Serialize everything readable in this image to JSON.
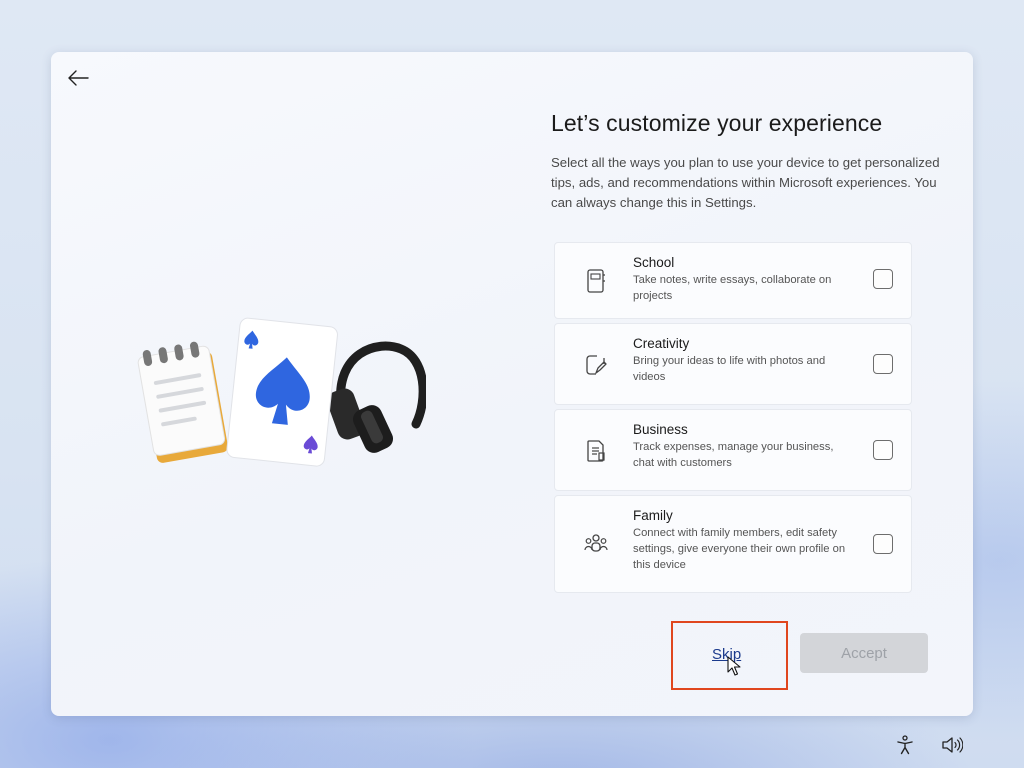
{
  "header": {
    "title": "Let’s customize your experience",
    "description": "Select all the ways you plan to use your device to get personalized tips, ads, and recommendations within Microsoft experiences. You can always change this in Settings."
  },
  "navigation": {
    "back_icon": "arrow-left-icon"
  },
  "illustration": {
    "icons": [
      "notepad-icon",
      "playing-card-spade-icon",
      "headphones-icon"
    ],
    "accent": "#3a5bd9"
  },
  "options": [
    {
      "label": "School",
      "description": "Take notes, write essays, collaborate on projects",
      "icon": "notebook-icon",
      "checked": false
    },
    {
      "label": "Creativity",
      "description": "Bring your ideas to life with photos and videos",
      "icon": "draw-image-icon",
      "checked": false
    },
    {
      "label": "Business",
      "description": "Track expenses, manage your business, chat with customers",
      "icon": "receipt-icon",
      "checked": false
    },
    {
      "label": "Family",
      "description": "Connect with family members, edit safety settings, give everyone their own profile on this device",
      "icon": "people-icon",
      "checked": false
    }
  ],
  "actions": {
    "skip_label": "Skip",
    "accept_label": "Accept",
    "highlight_color": "#e0461e"
  },
  "system_tray": {
    "icons": [
      "accessibility-icon",
      "volume-icon"
    ]
  }
}
